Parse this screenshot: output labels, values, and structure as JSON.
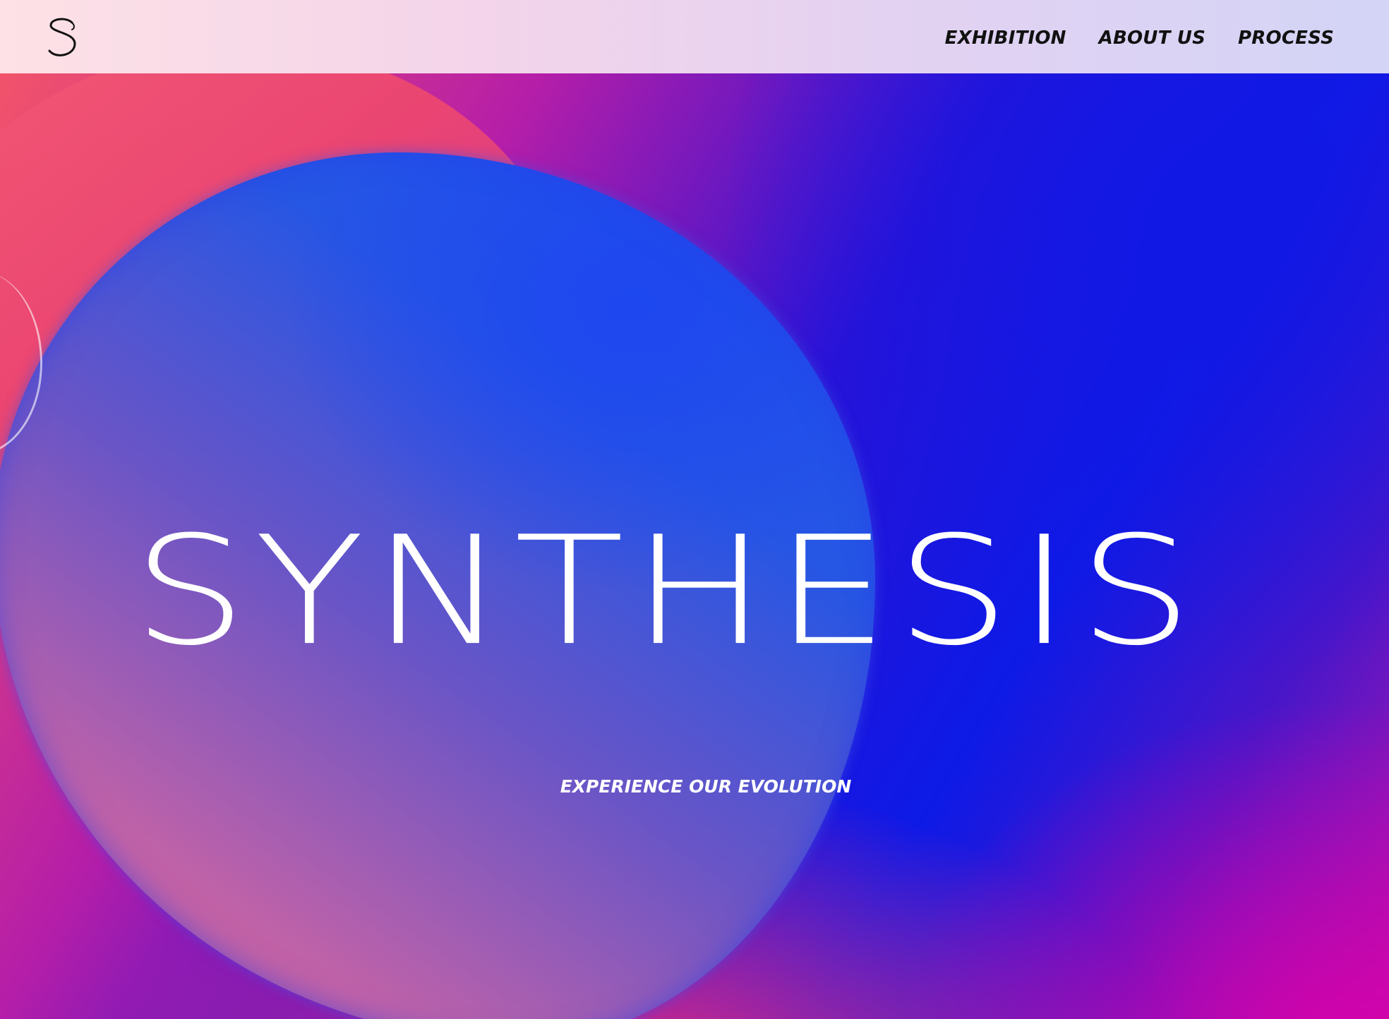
{
  "header": {
    "logo_icon": "synthesis-s-logo-icon",
    "nav": [
      {
        "label": "EXHIBITION"
      },
      {
        "label": "ABOUT US"
      },
      {
        "label": "PROCESS"
      }
    ]
  },
  "hero": {
    "title": "SYNTHESIS",
    "tagline": "EXPERIENCE OUR EVOLUTION"
  },
  "colors": {
    "header_bg_start": "#fde1e6",
    "header_bg_end": "#d3d4f6",
    "nav_text": "#111111",
    "hero_pink": "#f2536a",
    "hero_blue": "#0d1ae6",
    "hero_magenta": "#d600aa",
    "text_light": "#ffffff"
  }
}
